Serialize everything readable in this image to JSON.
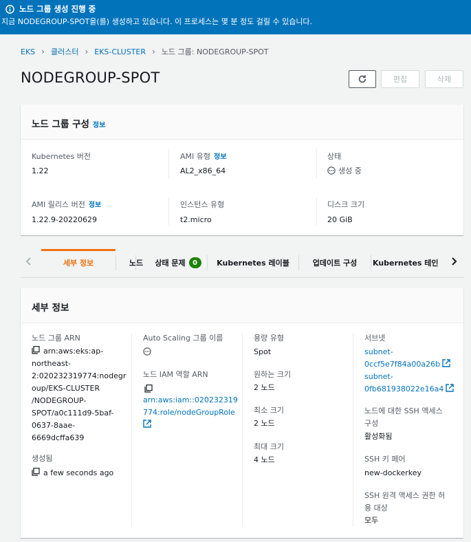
{
  "banner": {
    "title": "노드 그룹 생성 진행 중",
    "message": "지금 NODEGROUP-SPOT을(를) 생성하고 있습니다. 이 프로세스는 몇 분 정도 걸릴 수 있습니다.",
    "color": "#0073bb"
  },
  "breadcrumbs": [
    "EKS",
    "클러스터",
    "EKS-CLUSTER",
    "노드 그룹: NODEGROUP-SPOT"
  ],
  "page_title": "NODEGROUP-SPOT",
  "actions": {
    "edit": "편집",
    "delete": "삭제"
  },
  "config": {
    "title": "노드 그룹 구성",
    "info": "정보",
    "k8s_label": "Kubernetes 버전",
    "k8s_value": "1.22",
    "ami_type_label": "AMI 유형",
    "ami_type_info": "정보",
    "ami_type_value": "AL2_x86_64",
    "status_label": "상태",
    "status_value": "생성 중",
    "ami_release_label": "AMI 릴리스 버전",
    "ami_release_info": "정보",
    "ami_release_value": "1.22.9-20220629",
    "instance_label": "인스턴스 유형",
    "instance_value": "t2.micro",
    "disk_label": "디스크 크기",
    "disk_value": "20 GiB"
  },
  "tabs": {
    "details": "세부 정보",
    "nodes": "노드",
    "health": "상태 문제",
    "health_count": "0",
    "labels": "Kubernetes 레이블",
    "update": "업데이트 구성",
    "taints": "Kubernetes 테인"
  },
  "details": {
    "title": "세부 정보",
    "arn_label": "노드 그룹 ARN",
    "arn_lines": [
      "arn:aws:eks:ap-",
      "northeast-",
      "2:020232319774:nodegr",
      "oup/EKS-CLUSTER",
      "/NODEGROUP-",
      "SPOT/a0c111d9-5baf-",
      "0637-8aae-",
      "6669dcffa639"
    ],
    "created_label": "생성됨",
    "created_value": "a few seconds ago",
    "asg_label": "Auto Scaling 그룹 이름",
    "iam_label": "노드 IAM 역할 ARN",
    "iam_lines": [
      "arn:aws:iam::020232319",
      "774:role/nodeGroupRole"
    ],
    "capacity_label": "용량 유형",
    "capacity_value": "Spot",
    "desired_label": "원하는 크기",
    "desired_value": "2 노드",
    "min_label": "최소 크기",
    "min_value": "2 노드",
    "max_label": "최대 크기",
    "max_value": "4 노드",
    "subnet_label": "서브넷",
    "subnet1_lines": [
      "subnet-",
      "0ccf5e7f84a00a26b"
    ],
    "subnet2_lines": [
      "subnet-",
      "0fb681938022e16a4"
    ],
    "ssh_access_label_lines": [
      "노드에 대한 SSH 액세스",
      "구성"
    ],
    "ssh_access_value": "활성화됨",
    "ssh_key_label": "SSH 키 페어",
    "ssh_key_value": "new-dockerkey",
    "ssh_remote_label_lines": [
      "SSH 원격 액세스 권한 허",
      "용 대상"
    ],
    "ssh_remote_value": "모두"
  }
}
